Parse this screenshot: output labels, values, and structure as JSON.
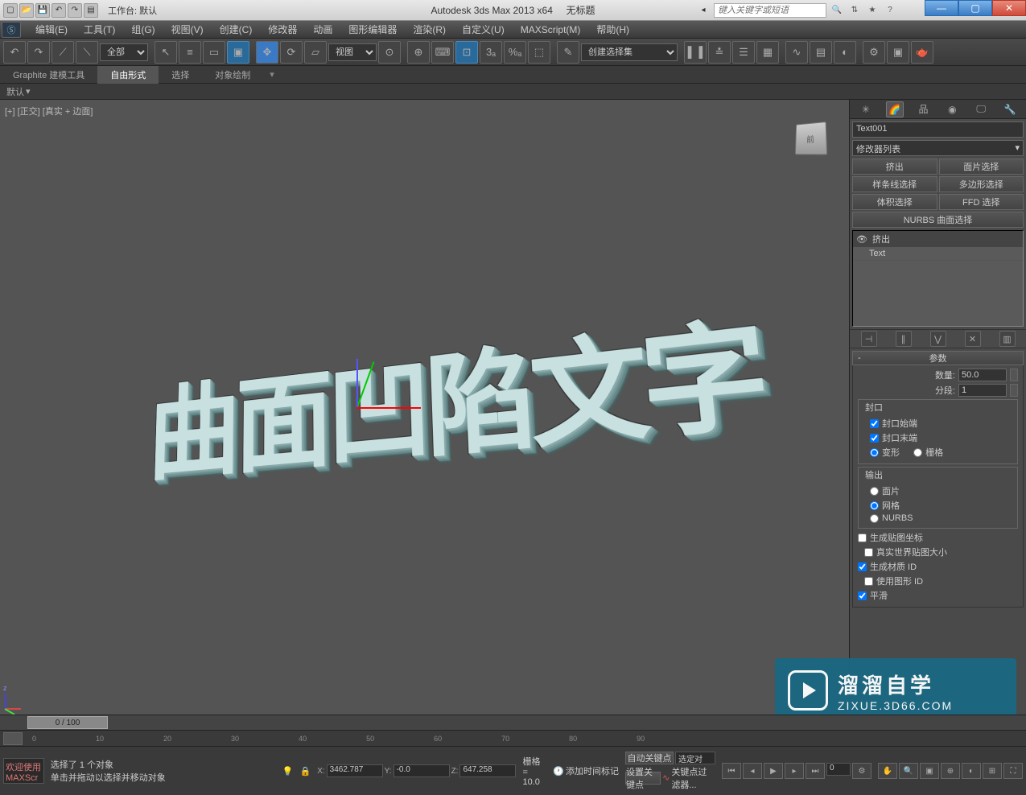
{
  "title": {
    "app": "Autodesk 3ds Max  2013 x64",
    "doc": "无标题",
    "workspace_label": "工作台: 默认"
  },
  "search": {
    "placeholder": "键入关键字或短语"
  },
  "menu": {
    "items": [
      "编辑(E)",
      "工具(T)",
      "组(G)",
      "视图(V)",
      "创建(C)",
      "修改器",
      "动画",
      "图形编辑器",
      "渲染(R)",
      "自定义(U)",
      "MAXScript(M)",
      "帮助(H)"
    ]
  },
  "toolbar": {
    "selection_filter": "全部",
    "ref_coord": "视图",
    "named_sets": "创建选择集"
  },
  "ribbon": {
    "tabs": [
      "Graphite 建模工具",
      "自由形式",
      "选择",
      "对象绘制"
    ],
    "active": 1,
    "sub": "默认"
  },
  "viewport": {
    "label": "[+] [正交] [真实 + 边面]",
    "cube_face": "前",
    "text3d": "曲面凹陷文字"
  },
  "cmd": {
    "obj_name": "Text001",
    "mod_list": "修改器列表",
    "mod_buttons": [
      "挤出",
      "面片选择",
      "样条线选择",
      "多边形选择",
      "体积选择",
      "FFD 选择"
    ],
    "nurbs_btn": "NURBS 曲面选择",
    "stack": {
      "mod": "挤出",
      "base": "Text"
    },
    "rollout_title": "参数",
    "params": {
      "amount_label": "数量:",
      "amount": "50.0",
      "segs_label": "分段:",
      "segs": "1",
      "cap_group": "封口",
      "cap_start": "封口始端",
      "cap_end": "封口末端",
      "morph": "变形",
      "grid": "栅格",
      "output_group": "输出",
      "out_patch": "面片",
      "out_mesh": "网格",
      "out_nurbs": "NURBS",
      "gen_map": "生成贴图坐标",
      "real_world": "真实世界贴图大小",
      "gen_mat": "生成材质 ID",
      "use_shape": "使用图形 ID",
      "smooth": "平滑"
    }
  },
  "status": {
    "frame": "0 / 100",
    "sel": "选择了 1 个对象",
    "hint": "单击并拖动以选择并移动对象",
    "welcome": "欢迎使用  MAXScr",
    "x": "3462.787",
    "y": "-0.0",
    "z": "647.258",
    "grid": "栅格 = 10.0",
    "autokey": "自动关键点",
    "setkey": "设置关键点",
    "sel_locked": "选定对",
    "keyfilters": "关键点过滤器...",
    "add_time_tag": "添加时间标记",
    "mini_listener": "0"
  },
  "watermark": {
    "line1": "溜溜自学",
    "line2": "ZIXUE.3D66.COM"
  },
  "ticks": [
    "0",
    "10",
    "20",
    "30",
    "40",
    "50",
    "60",
    "70",
    "80",
    "90"
  ]
}
